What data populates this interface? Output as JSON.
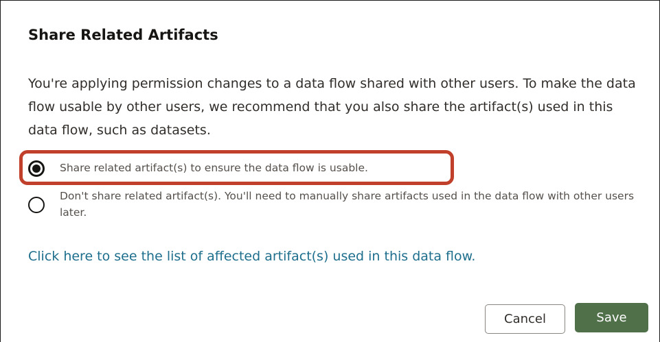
{
  "dialog": {
    "title": "Share Related Artifacts",
    "description": "You're applying permission changes to a data flow shared with other users. To make the data flow usable by other users, we recommend that you also share the artifact(s) used in this data flow, such as datasets.",
    "options": [
      {
        "label": "Share related artifact(s) to ensure the data flow is usable.",
        "selected": true
      },
      {
        "label": "Don't share related artifact(s). You'll need to manually share artifacts used in the data flow with other users later.",
        "selected": false
      }
    ],
    "link_text": "Click here to see the list of affected artifact(s) used in this data flow.",
    "cancel_label": "Cancel",
    "save_label": "Save"
  },
  "colors": {
    "highlight": "#c0402b",
    "link": "#1d6e8c",
    "primary_button": "#50704a"
  }
}
